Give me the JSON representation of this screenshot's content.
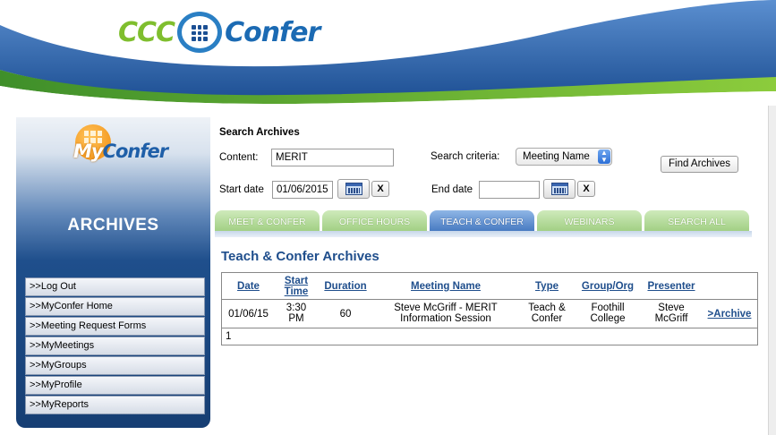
{
  "header": {
    "logo_left": "CCC",
    "logo_right": "Confer"
  },
  "sidebar": {
    "logo_my": "My",
    "logo_confer": "Confer",
    "title": "ARCHIVES",
    "items": [
      {
        "label": ">>Log Out"
      },
      {
        "label": ">>MyConfer Home"
      },
      {
        "label": ">>Meeting Request Forms"
      },
      {
        "label": ">>MyMeetings"
      },
      {
        "label": ">>MyGroups"
      },
      {
        "label": ">>MyProfile"
      },
      {
        "label": ">>MyReports"
      }
    ]
  },
  "search": {
    "title": "Search Archives",
    "content_label": "Content:",
    "content_value": "MERIT",
    "criteria_label": "Search criteria:",
    "criteria_value": "Meeting Name",
    "find_button": "Find Archives",
    "start_label": "Start date",
    "start_value": "01/06/2015",
    "end_label": "End date",
    "end_value": "",
    "clear_label": "X"
  },
  "tabs": [
    {
      "label": "MEET & CONFER",
      "active": false
    },
    {
      "label": "OFFICE HOURS",
      "active": false
    },
    {
      "label": "TEACH & CONFER",
      "active": true
    },
    {
      "label": "WEBINARS",
      "active": false
    },
    {
      "label": "SEARCH ALL",
      "active": false
    }
  ],
  "archives": {
    "heading": "Teach & Confer Archives",
    "columns": {
      "date": "Date",
      "start_time_1": "Start",
      "start_time_2": "Time",
      "duration": "Duration",
      "meeting_name": "Meeting Name",
      "type": "Type",
      "group": "Group/Org",
      "presenter": "Presenter"
    },
    "rows": [
      {
        "date": "01/06/15",
        "time_1": "3:30",
        "time_2": "PM",
        "duration": "60",
        "name_1": "Steve McGriff - MERIT",
        "name_2": "Information Session",
        "type_1": "Teach &",
        "type_2": "Confer",
        "group_1": "Foothill",
        "group_2": "College",
        "presenter_1": "Steve",
        "presenter_2": "McGriff",
        "action": ">Archive"
      }
    ],
    "pager": "1"
  },
  "colors": {
    "brand_blue": "#1f4e8c",
    "brand_green": "#7fbe2e",
    "tab_active": "#3f73bd",
    "tab_inactive": "#9ccc7d"
  }
}
